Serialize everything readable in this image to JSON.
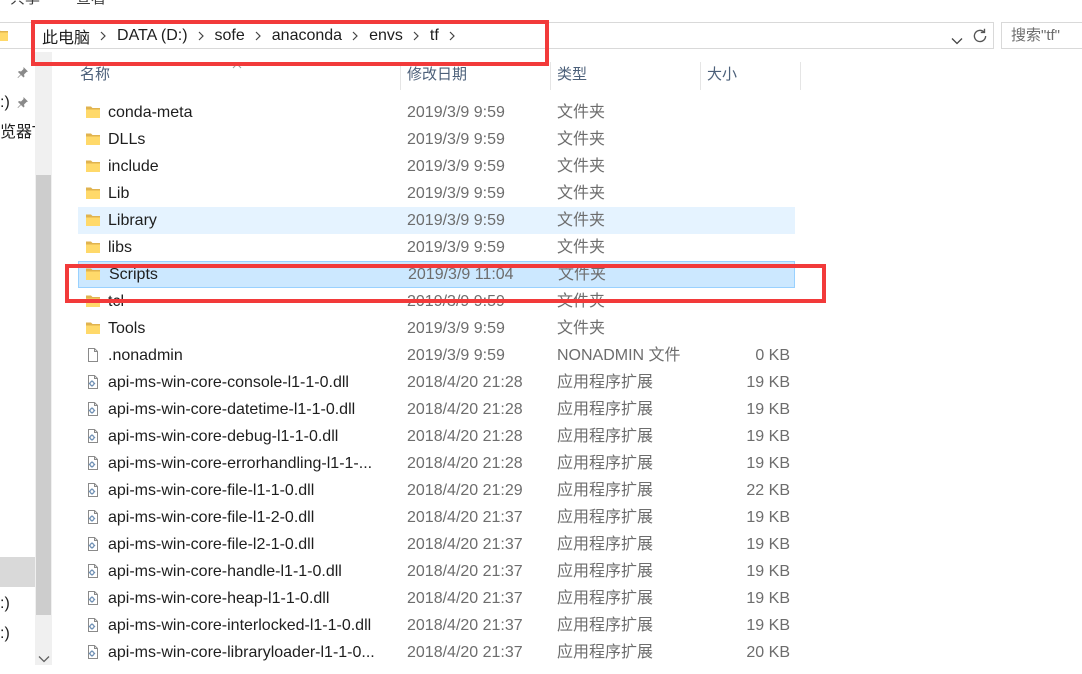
{
  "ribbon": {
    "tabs": [
      "共享",
      "查看"
    ]
  },
  "address": {
    "crumbs": [
      "此电脑",
      "DATA (D:)",
      "sofe",
      "anaconda",
      "envs",
      "tf"
    ]
  },
  "search": {
    "placeholder": "搜索\"tf\""
  },
  "columns": {
    "name": "名称",
    "date": "修改日期",
    "type": "类型",
    "size": "大小"
  },
  "nav": {
    "items": [
      ":)",
      "览器T",
      ":)",
      ":)"
    ]
  },
  "colors": {
    "annotation": "#f23a3a",
    "hover": "#e5f3ff",
    "selected": "#cce8ff",
    "selected_border": "#99d1ff",
    "folder": "#ffd96a"
  },
  "files": [
    {
      "name": "conda-meta",
      "date": "2019/3/9 9:59",
      "type": "文件夹",
      "icon": "folder-icon"
    },
    {
      "name": "DLLs",
      "date": "2019/3/9 9:59",
      "type": "文件夹",
      "icon": "folder-icon"
    },
    {
      "name": "include",
      "date": "2019/3/9 9:59",
      "type": "文件夹",
      "icon": "folder-icon"
    },
    {
      "name": "Lib",
      "date": "2019/3/9 9:59",
      "type": "文件夹",
      "icon": "folder-icon"
    },
    {
      "name": "Library",
      "date": "2019/3/9 9:59",
      "type": "文件夹",
      "icon": "folder-icon",
      "state": "hover"
    },
    {
      "name": "libs",
      "date": "2019/3/9 9:59",
      "type": "文件夹",
      "icon": "folder-icon"
    },
    {
      "name": "Scripts",
      "date": "2019/3/9 11:04",
      "type": "文件夹",
      "icon": "folder-icon",
      "state": "selected"
    },
    {
      "name": "tcl",
      "date": "2019/3/9 9:59",
      "type": "文件夹",
      "icon": "folder-icon"
    },
    {
      "name": "Tools",
      "date": "2019/3/9 9:59",
      "type": "文件夹",
      "icon": "folder-icon"
    },
    {
      "name": ".nonadmin",
      "date": "2019/3/9 9:59",
      "type": "NONADMIN 文件",
      "size": "0 KB",
      "icon": "file-icon"
    },
    {
      "name": "api-ms-win-core-console-l1-1-0.dll",
      "date": "2018/4/20 21:28",
      "type": "应用程序扩展",
      "size": "19 KB",
      "icon": "dll-icon"
    },
    {
      "name": "api-ms-win-core-datetime-l1-1-0.dll",
      "date": "2018/4/20 21:28",
      "type": "应用程序扩展",
      "size": "19 KB",
      "icon": "dll-icon"
    },
    {
      "name": "api-ms-win-core-debug-l1-1-0.dll",
      "date": "2018/4/20 21:28",
      "type": "应用程序扩展",
      "size": "19 KB",
      "icon": "dll-icon"
    },
    {
      "name": "api-ms-win-core-errorhandling-l1-1-...",
      "date": "2018/4/20 21:28",
      "type": "应用程序扩展",
      "size": "19 KB",
      "icon": "dll-icon"
    },
    {
      "name": "api-ms-win-core-file-l1-1-0.dll",
      "date": "2018/4/20 21:29",
      "type": "应用程序扩展",
      "size": "22 KB",
      "icon": "dll-icon"
    },
    {
      "name": "api-ms-win-core-file-l1-2-0.dll",
      "date": "2018/4/20 21:37",
      "type": "应用程序扩展",
      "size": "19 KB",
      "icon": "dll-icon"
    },
    {
      "name": "api-ms-win-core-file-l2-1-0.dll",
      "date": "2018/4/20 21:37",
      "type": "应用程序扩展",
      "size": "19 KB",
      "icon": "dll-icon"
    },
    {
      "name": "api-ms-win-core-handle-l1-1-0.dll",
      "date": "2018/4/20 21:37",
      "type": "应用程序扩展",
      "size": "19 KB",
      "icon": "dll-icon"
    },
    {
      "name": "api-ms-win-core-heap-l1-1-0.dll",
      "date": "2018/4/20 21:37",
      "type": "应用程序扩展",
      "size": "19 KB",
      "icon": "dll-icon"
    },
    {
      "name": "api-ms-win-core-interlocked-l1-1-0.dll",
      "date": "2018/4/20 21:37",
      "type": "应用程序扩展",
      "size": "19 KB",
      "icon": "dll-icon"
    },
    {
      "name": "api-ms-win-core-libraryloader-l1-1-0...",
      "date": "2018/4/20 21:37",
      "type": "应用程序扩展",
      "size": "20 KB",
      "icon": "dll-icon"
    }
  ]
}
